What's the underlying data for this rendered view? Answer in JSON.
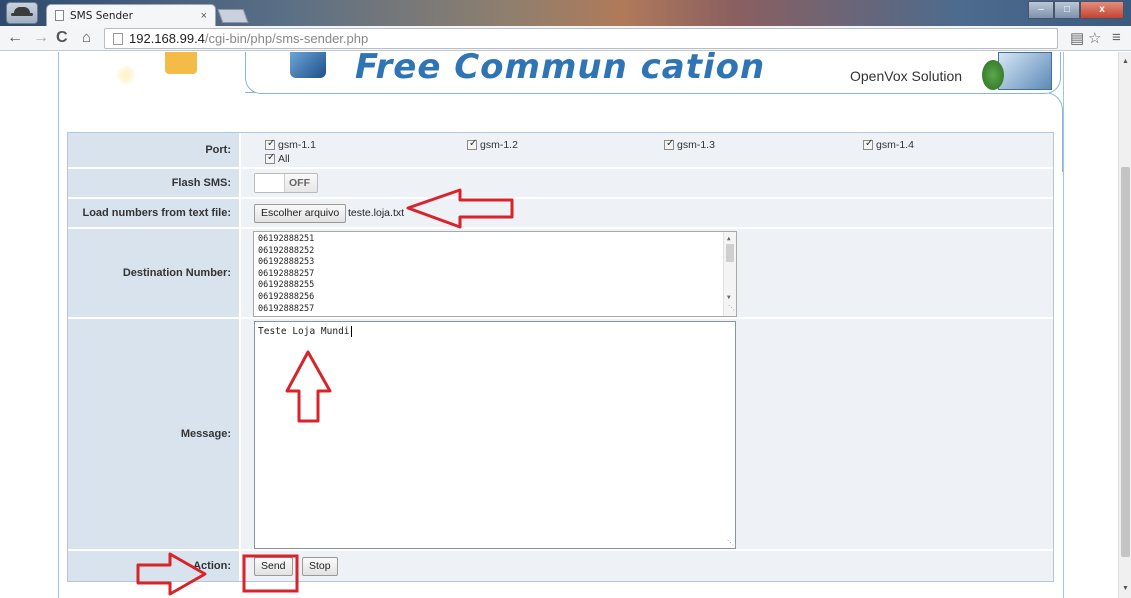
{
  "browser": {
    "tab_title": "SMS Sender",
    "tab_close": "×",
    "url_host": "192.168.99.4",
    "url_path": "/cgi-bin/php/sms-sender.php",
    "window_controls": {
      "minimize": "–",
      "maximize": "□",
      "close": "x"
    }
  },
  "banner": {
    "title": "Free Commun  cation",
    "brand": "OpenVox Solution"
  },
  "form": {
    "port": {
      "label": "Port:",
      "options": [
        {
          "label": "gsm-1.1",
          "checked": true
        },
        {
          "label": "gsm-1.2",
          "checked": true
        },
        {
          "label": "gsm-1.3",
          "checked": true
        },
        {
          "label": "gsm-1.4",
          "checked": true
        },
        {
          "label": "All",
          "checked": true
        }
      ]
    },
    "flash_sms": {
      "label": "Flash SMS:",
      "state": "OFF"
    },
    "load_numbers": {
      "label": "Load numbers from text file:",
      "button": "Escolher arquivo",
      "file_name": "teste.loja.txt"
    },
    "destination": {
      "label": "Destination Number:",
      "numbers": [
        "06192888251",
        "06192888252",
        "06192888253",
        "06192888257",
        "06192888255",
        "06192888256",
        "06192888257"
      ]
    },
    "message": {
      "label": "Message:",
      "value": "Teste Loja Mundi"
    },
    "action": {
      "label": "Action:",
      "send": "Send",
      "stop": "Stop"
    }
  },
  "colors": {
    "annotation": "#d8232a",
    "label_bg": "#d9e3ee",
    "value_bg": "#eef2f7",
    "banner_blue": "#2f74b5"
  }
}
